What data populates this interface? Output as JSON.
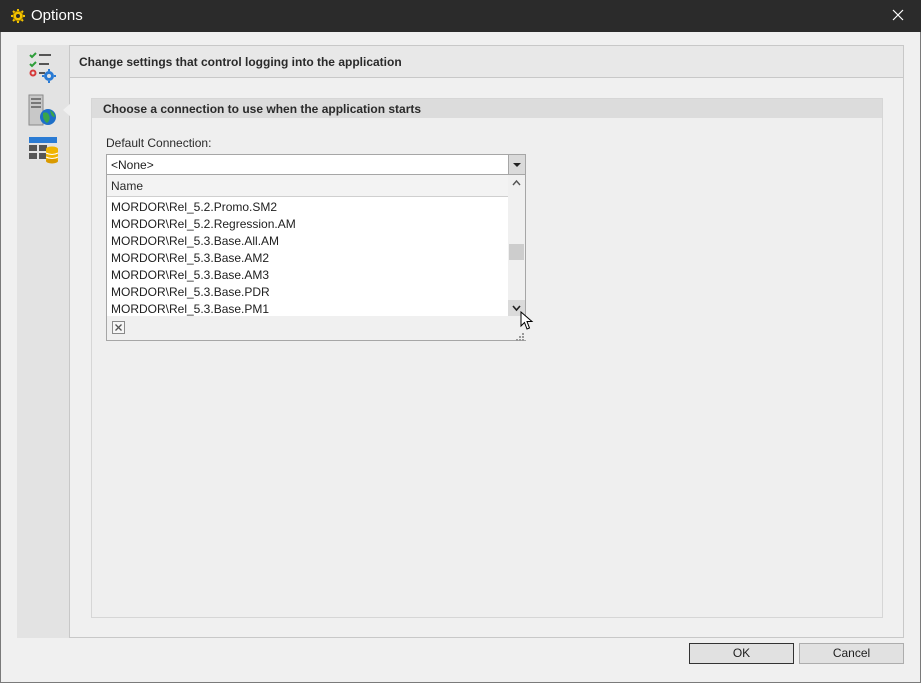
{
  "window": {
    "title": "Options",
    "accent": "#2b2b2b"
  },
  "nav": {
    "items": [
      {
        "name": "general-settings",
        "icon": "checklist-gear-icon"
      },
      {
        "name": "logon-settings",
        "icon": "server-globe-icon",
        "selected": true
      },
      {
        "name": "database-settings",
        "icon": "table-database-icon"
      }
    ]
  },
  "header": {
    "text": "Change settings that control logging into the application"
  },
  "group": {
    "title": "Choose a connection to use when the application starts"
  },
  "default_connection": {
    "label": "Default Connection:",
    "value": "<None>",
    "dropdown": {
      "column_header": "Name",
      "items": [
        "MORDOR\\Rel_5.2.Promo.SM2",
        "MORDOR\\Rel_5.2.Regression.AM",
        "MORDOR\\Rel_5.3.Base.All.AM",
        "MORDOR\\Rel_5.3.Base.AM2",
        "MORDOR\\Rel_5.3.Base.AM3",
        "MORDOR\\Rel_5.3.Base.PDR",
        "MORDOR\\Rel_5.3.Base.PM1"
      ]
    }
  },
  "buttons": {
    "ok": "OK",
    "cancel": "Cancel"
  }
}
